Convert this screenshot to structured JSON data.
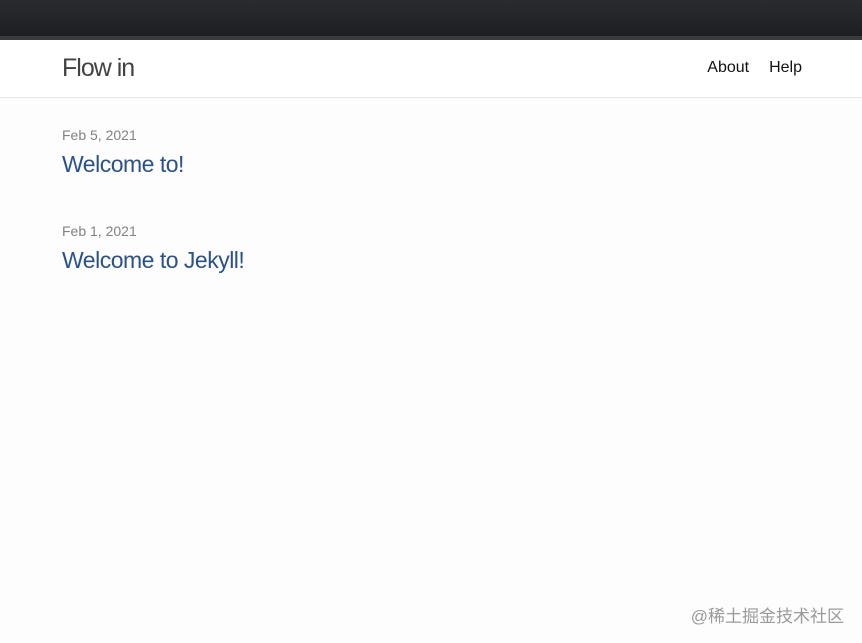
{
  "header": {
    "site_title": "Flow in",
    "nav": [
      {
        "label": "About"
      },
      {
        "label": "Help"
      }
    ]
  },
  "posts": [
    {
      "date": "Feb 5, 2021",
      "title": "Welcome to!"
    },
    {
      "date": "Feb 1, 2021",
      "title": "Welcome to Jekyll!"
    }
  ],
  "watermark": "@稀土掘金技术社区",
  "colors": {
    "link": "#2a5289",
    "meta": "#828282",
    "title": "#424242",
    "chrome": "#1d1e21"
  }
}
